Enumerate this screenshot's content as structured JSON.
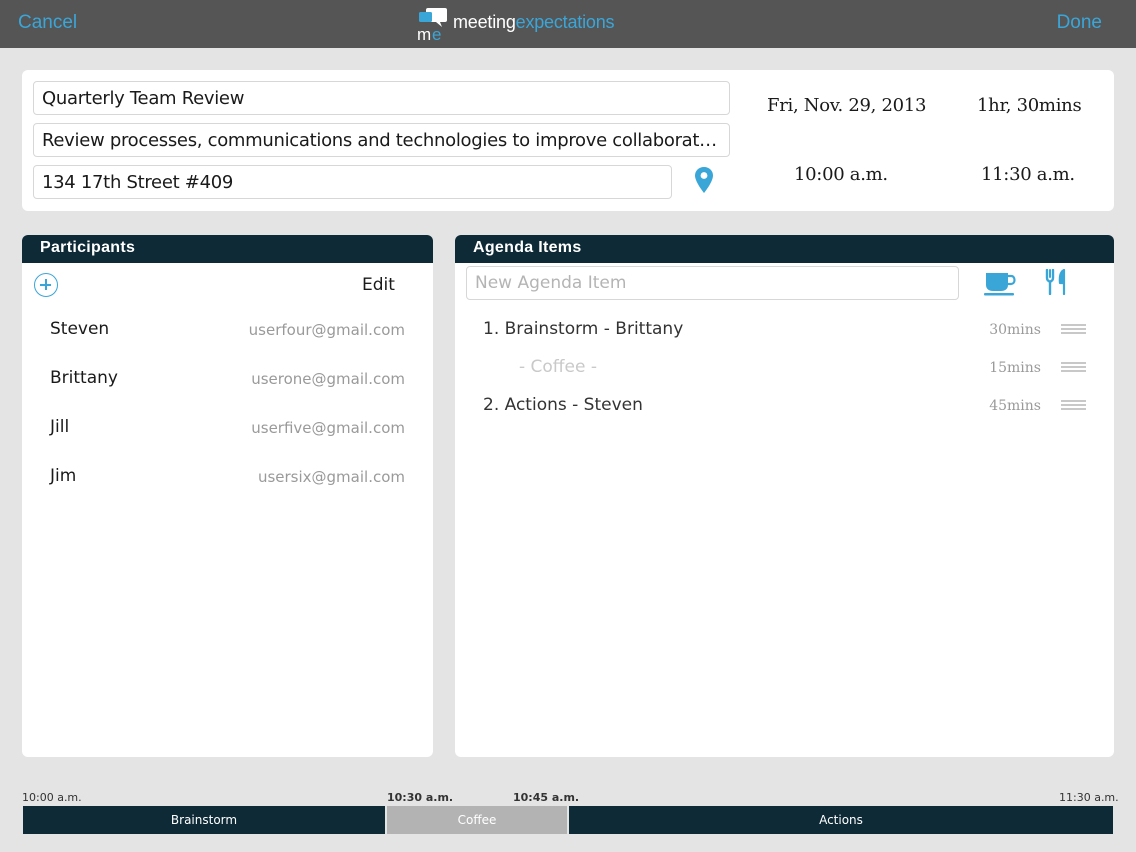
{
  "topbar": {
    "cancel": "Cancel",
    "done": "Done",
    "logo_word_1": "meeting",
    "logo_word_2": "expectations",
    "logo_mark": "me"
  },
  "meeting": {
    "title": "Quarterly Team Review",
    "description": "Review processes, communications and technologies to improve collaboration, act on l...",
    "location": "134 17th Street #409",
    "date": "Fri, Nov. 29, 2013",
    "duration": "1hr, 30mins",
    "start_time": "10:00 a.m.",
    "end_time": "11:30 a.m."
  },
  "participants": {
    "header": "Participants",
    "edit_label": "Edit",
    "people": [
      {
        "name": "Steven",
        "email": "userfour@gmail.com"
      },
      {
        "name": "Brittany",
        "email": "userone@gmail.com"
      },
      {
        "name": "Jill",
        "email": "userfive@gmail.com"
      },
      {
        "name": "Jim",
        "email": "usersix@gmail.com"
      }
    ]
  },
  "agenda": {
    "header": "Agenda Items",
    "new_item_placeholder": "New Agenda Item",
    "items": [
      {
        "label": "1. Brainstorm - Brittany",
        "duration": "30mins"
      },
      {
        "label": "- Coffee -",
        "duration": "15mins"
      },
      {
        "label": "2. Actions - Steven",
        "duration": "45mins"
      }
    ]
  },
  "timeline": {
    "labels": [
      "10:00 a.m.",
      "10:30 a.m.",
      "10:45 a.m.",
      "11:30 a.m."
    ],
    "segments": [
      "Brainstorm",
      "Coffee",
      "Actions"
    ]
  },
  "colors": {
    "accent": "#3aa6d8",
    "panel_header": "#0d2a36",
    "topbar": "#555556",
    "background": "#e4e4e5"
  },
  "icons": [
    "location-pin-icon",
    "add-circle-icon",
    "coffee-cup-icon",
    "fork-knife-icon",
    "drag-handle-icon"
  ]
}
